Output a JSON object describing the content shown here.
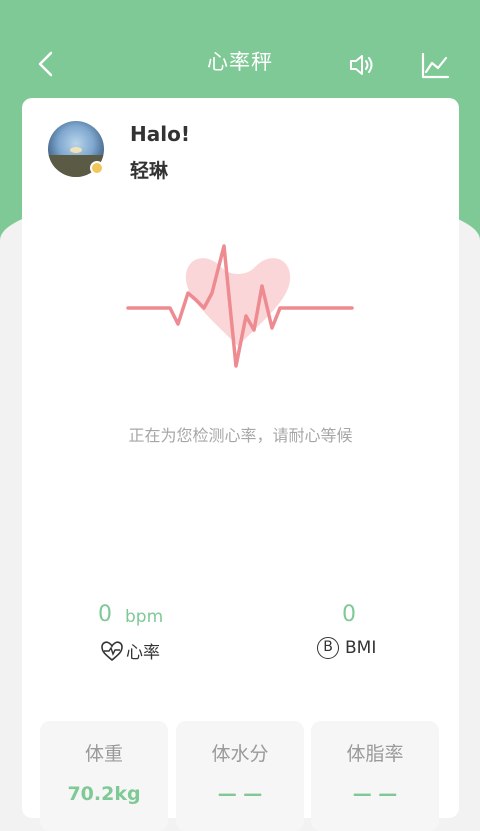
{
  "header": {
    "title": "心率秤",
    "back_icon": "chevron-left-icon",
    "sound_icon": "speaker-icon",
    "chart_icon": "trend-chart-icon"
  },
  "profile": {
    "greeting": "Halo!",
    "name": "轻琳"
  },
  "detect_text": "正在为您检测心率，请耐心等候",
  "metrics": {
    "heart_rate": {
      "value": "0",
      "unit": "bpm",
      "label": "心率",
      "icon": "heart-pulse-icon"
    },
    "bmi": {
      "value": "0",
      "label": "BMI",
      "icon_letter": "B"
    }
  },
  "stats": [
    {
      "label": "体重",
      "value": "70.2kg"
    },
    {
      "label": "体水分",
      "value": "— —"
    },
    {
      "label": "体脂率",
      "value": "— —"
    }
  ],
  "colors": {
    "accent": "#7ec995",
    "heart_fill": "#fbd6d8",
    "pulse_line": "#ee8b91"
  }
}
